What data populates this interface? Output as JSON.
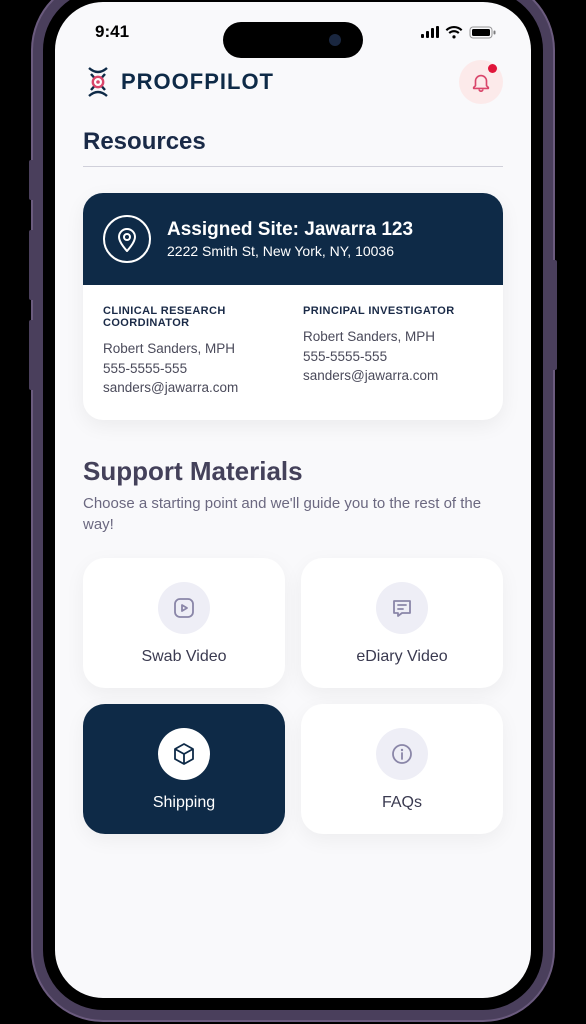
{
  "status": {
    "time": "9:41"
  },
  "header": {
    "brand": "PROOFPILOT"
  },
  "page": {
    "title": "Resources"
  },
  "site": {
    "title": "Assigned Site: Jawarra 123",
    "address": "2222 Smith St, New York, NY, 10036",
    "contacts": [
      {
        "role": "CLINICAL RESEARCH COORDINATOR",
        "name": "Robert Sanders, MPH",
        "phone": "555-5555-555",
        "email": "sanders@jawarra.com"
      },
      {
        "role": "PRINCIPAL INVESTIGATOR",
        "name": "Robert Sanders, MPH",
        "phone": "555-5555-555",
        "email": "sanders@jawarra.com"
      }
    ]
  },
  "support": {
    "title": "Support Materials",
    "subtitle": "Choose a starting point and we'll guide you to the rest of the way!",
    "tiles": [
      {
        "label": "Swab Video"
      },
      {
        "label": "eDiary Video"
      },
      {
        "label": "Shipping"
      },
      {
        "label": "FAQs"
      }
    ]
  }
}
